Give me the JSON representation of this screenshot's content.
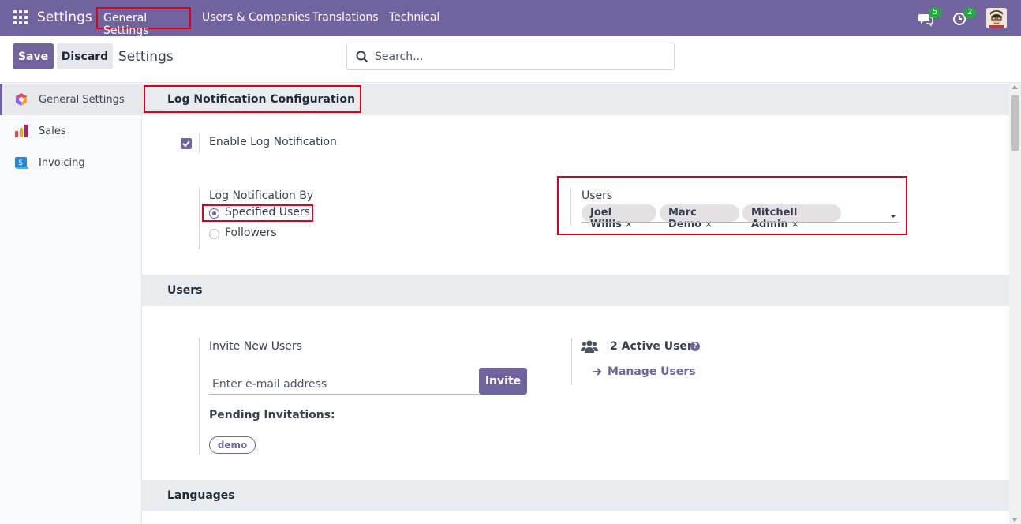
{
  "navbar": {
    "app_name": "Settings",
    "menu": [
      "General Settings",
      "Users & Companies",
      "Translations",
      "Technical"
    ],
    "messages_count": "5",
    "activities_count": "2"
  },
  "control": {
    "save_label": "Save",
    "discard_label": "Discard",
    "title": "Settings",
    "search_placeholder": "Search..."
  },
  "sidebar": {
    "items": [
      {
        "label": "General Settings",
        "icon": "general-settings-icon",
        "active": true
      },
      {
        "label": "Sales",
        "icon": "sales-icon"
      },
      {
        "label": "Invoicing",
        "icon": "invoicing-icon"
      }
    ]
  },
  "log_section": {
    "header": "Log Notification Configuration",
    "enable_label": "Enable Log Notification",
    "enabled": true,
    "by_label": "Log Notification By",
    "options": [
      "Specified Users",
      "Followers"
    ],
    "selected": "Specified Users",
    "users_label": "Users",
    "users": [
      "Joel Willis",
      "Marc Demo",
      "Mitchell Admin"
    ]
  },
  "users_section": {
    "header": "Users",
    "invite_label": "Invite New Users",
    "email_placeholder": "Enter e-mail address",
    "invite_button": "Invite",
    "pending_label": "Pending Invitations:",
    "pending": [
      "demo"
    ],
    "active_users": "2 Active Users",
    "manage_users": "Manage Users"
  },
  "languages_section": {
    "header": "Languages"
  },
  "colors": {
    "brand": "#71639e",
    "highlight": "#e0001b"
  }
}
